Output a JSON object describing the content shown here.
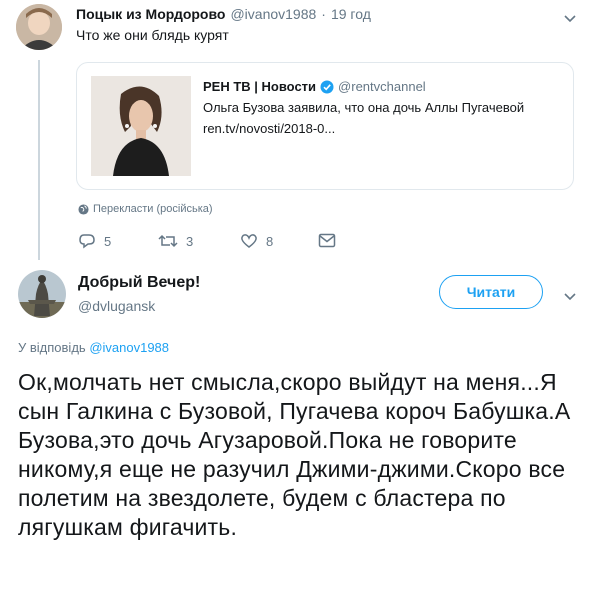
{
  "tweet": {
    "author_name": "Поцык из Мордорово",
    "author_handle": "@ivanov1988",
    "separator": "·",
    "time": "19 год",
    "text": "Что же они блядь курят",
    "card": {
      "source_name": "РЕН ТВ | Новости",
      "source_handle": "@rentvchannel",
      "title": "Ольга Бузова заявила, что она дочь Аллы Пугачевой",
      "url": "ren.tv/novosti/2018-0..."
    },
    "translate_label": "Перекласти (російська)",
    "actions": {
      "replies": "5",
      "retweets": "3",
      "likes": "8"
    }
  },
  "reply": {
    "author_name": "Добрый Вечер!",
    "author_handle": "@dvlugansk",
    "follow_label": "Читати",
    "in_reply_prefix": "У відповідь",
    "in_reply_handle": "@ivanov1988",
    "text": "Ок,молчать нет смысла,скоро выйдут на меня...Я сын Галкина с Бузовой, Пугачева короч Бабушка.А Бузова,это дочь Агузаровой.Пока не говорите никому,я еще не разучил Джими-джими.Скоро все полетим на звездолете, будем с бластера по лягушкам  фигачить."
  },
  "colors": {
    "accent": "#1da1f2",
    "muted": "#657786",
    "border": "#e1e8ed",
    "thread": "#ccd6dd",
    "verified": "#1da1f2"
  },
  "icons": [
    "chevron-down-icon",
    "verified-badge-icon",
    "globe-icon",
    "reply-icon",
    "retweet-icon",
    "like-icon",
    "message-icon"
  ]
}
